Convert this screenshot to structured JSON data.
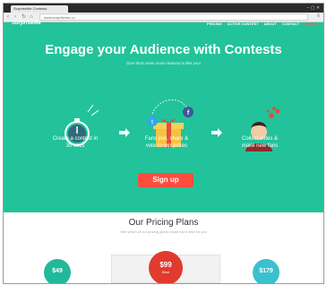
{
  "browser": {
    "tab_title": "SurpriseMe Contests",
    "url": "www.surpriseme.co"
  },
  "site": {
    "logo": "SurpriseMe",
    "nav": [
      "PRICING",
      "ACTIVE CONTEST",
      "ABOUT",
      "CONTACT"
    ],
    "signin": "SIGN IN"
  },
  "hero": {
    "headline": "Engage your Audience with Contests",
    "subheadline": "Give them even more reasons to like you!",
    "steps": [
      {
        "line1": "Create a contest in",
        "line2": "30 secs"
      },
      {
        "line1": "Fans join, share &",
        "line2": "vote to win prizes"
      },
      {
        "line1": "Collect votes &",
        "line2": "make new fans"
      }
    ],
    "signup_label": "Sign up"
  },
  "pricing": {
    "title": "Our Pricing Plans",
    "subtitle": "See which of our pricing plans would work best for you",
    "plans": [
      {
        "price": "$49",
        "color": "#22b89a"
      },
      {
        "price": "$99",
        "note": "Best",
        "color": "#e03b2e"
      },
      {
        "price": "$179",
        "color": "#3bc0cf"
      }
    ]
  }
}
